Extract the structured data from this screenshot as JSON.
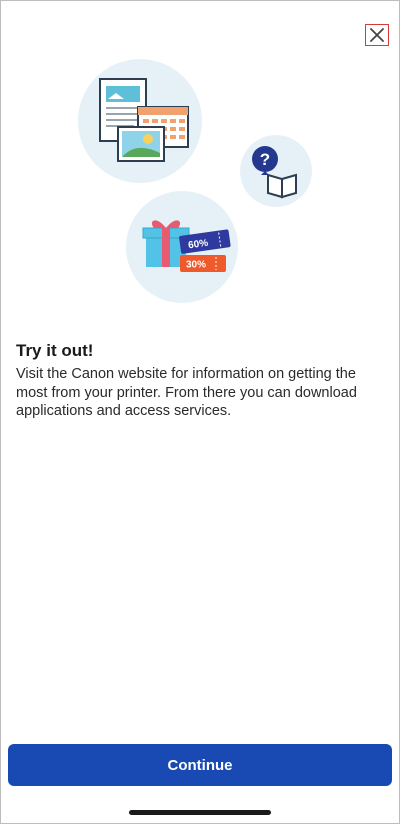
{
  "header": {
    "close_icon": "close-icon"
  },
  "illustration": {
    "discount_tags": [
      "60%",
      "30%"
    ],
    "help_symbol": "?"
  },
  "content": {
    "title": "Try it out!",
    "description": "Visit the Canon website for information on getting the most from your printer. From there you can download applications and access services."
  },
  "footer": {
    "continue_label": "Continue"
  },
  "colors": {
    "primary": "#1949b3",
    "circle_bg": "#e6f1f7",
    "close_highlight": "#d83a3a",
    "gift_body": "#52c3e6",
    "gift_ribbon": "#e85a6f",
    "tag_blue": "#2f3aa0",
    "tag_orange": "#ee5a2b"
  }
}
